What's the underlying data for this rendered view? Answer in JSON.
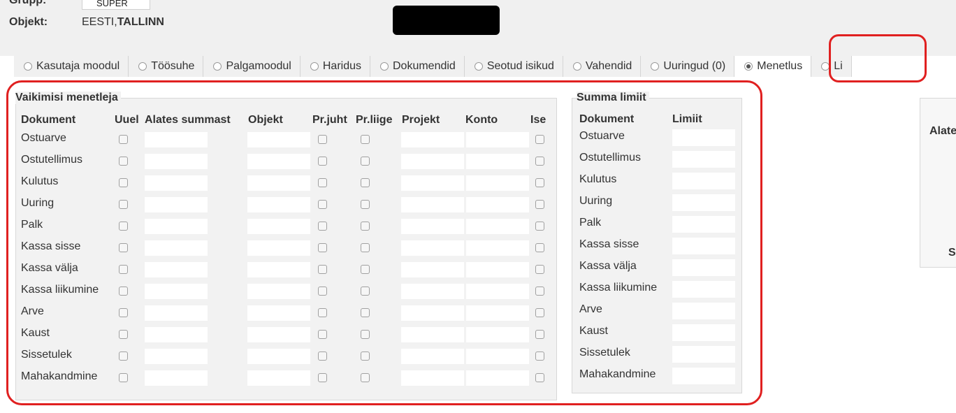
{
  "header": {
    "grupp_label": "Grupp:",
    "grupp_value": "SUPER",
    "objekt_label": "Objekt:",
    "objekt_value_plain": "EESTI,",
    "objekt_value_bold": "TALLINN"
  },
  "tabs": [
    {
      "label": "Kasutaja moodul",
      "active": false
    },
    {
      "label": "Töösuhe",
      "active": false
    },
    {
      "label": "Palgamoodul",
      "active": false
    },
    {
      "label": "Haridus",
      "active": false
    },
    {
      "label": "Dokumendid",
      "active": false
    },
    {
      "label": "Seotud isikud",
      "active": false
    },
    {
      "label": "Vahendid",
      "active": false
    },
    {
      "label": "Uuringud (0)",
      "active": false
    },
    {
      "label": "Menetlus",
      "active": true
    },
    {
      "label": "Li",
      "active": false
    }
  ],
  "vaikimisi": {
    "title": "Vaikimisi menetleja",
    "columns": [
      "Dokument",
      "Uuel",
      "Alates summast",
      "Objekt",
      "Pr.juht",
      "Pr.liige",
      "Projekt",
      "Konto",
      "Ise"
    ],
    "rows": [
      "Ostuarve",
      "Ostutellimus",
      "Kulutus",
      "Uuring",
      "Palk",
      "Kassa sisse",
      "Kassa välja",
      "Kassa liikumine",
      "Arve",
      "Kaust",
      "Sissetulek",
      "Mahakandmine"
    ]
  },
  "summa_limiit": {
    "title": "Summa limiit",
    "columns": [
      "Dokument",
      "Limiit"
    ],
    "rows": [
      "Ostuarve",
      "Ostutellimus",
      "Kulutus",
      "Uuring",
      "Palk",
      "Kassa sisse",
      "Kassa välja",
      "Kassa liikumine",
      "Arve",
      "Kaust",
      "Sissetulek",
      "Mahakandmine"
    ]
  },
  "right_panel": {
    "label1": "Alate",
    "label2": "S"
  },
  "colors": {
    "highlight": "#e02020",
    "background": "#f0f0f0"
  }
}
